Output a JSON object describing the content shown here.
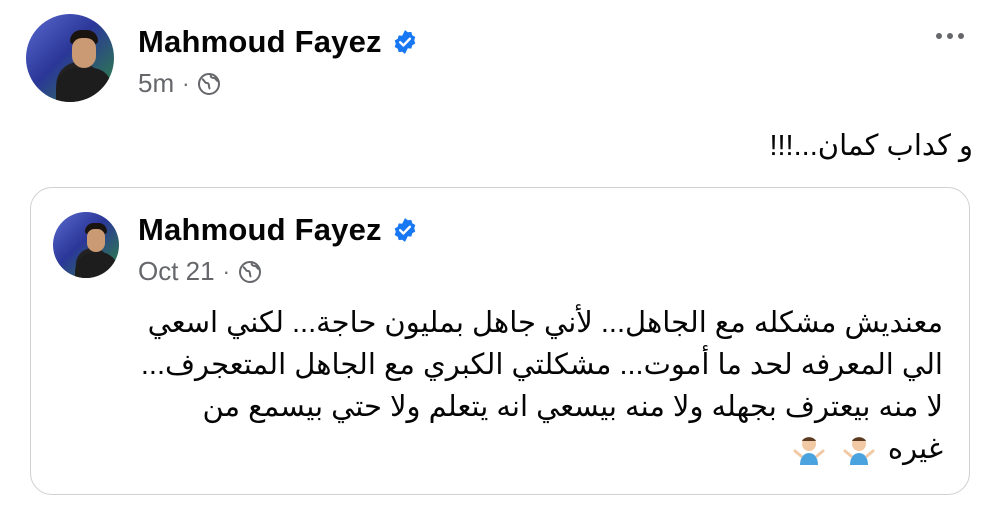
{
  "post": {
    "author": "Mahmoud Fayez",
    "time": "5m",
    "separator": "·",
    "privacy_icon": "globe-icon",
    "text": "و كداب كمان...!!!"
  },
  "shared_post": {
    "author": "Mahmoud Fayez",
    "time": "Oct 21",
    "separator": "·",
    "privacy_icon": "globe-icon",
    "lines": [
      "معنديش مشكله مع الجاهل... لأني جاهل بمليون حاجة... لكني اسعي",
      "الي المعرفه لحد ما أموت... مشكلتي الكبري مع الجاهل المتعجرف...",
      "لا منه بيعترف بجهله ولا منه بيسعي انه يتعلم ولا حتي بيسمع من",
      "غيره"
    ],
    "emoji": [
      "person-shrugging",
      "person-shrugging"
    ]
  },
  "colors": {
    "verified": "#1877f2",
    "meta": "#65676b",
    "border": "#ced0d4"
  }
}
